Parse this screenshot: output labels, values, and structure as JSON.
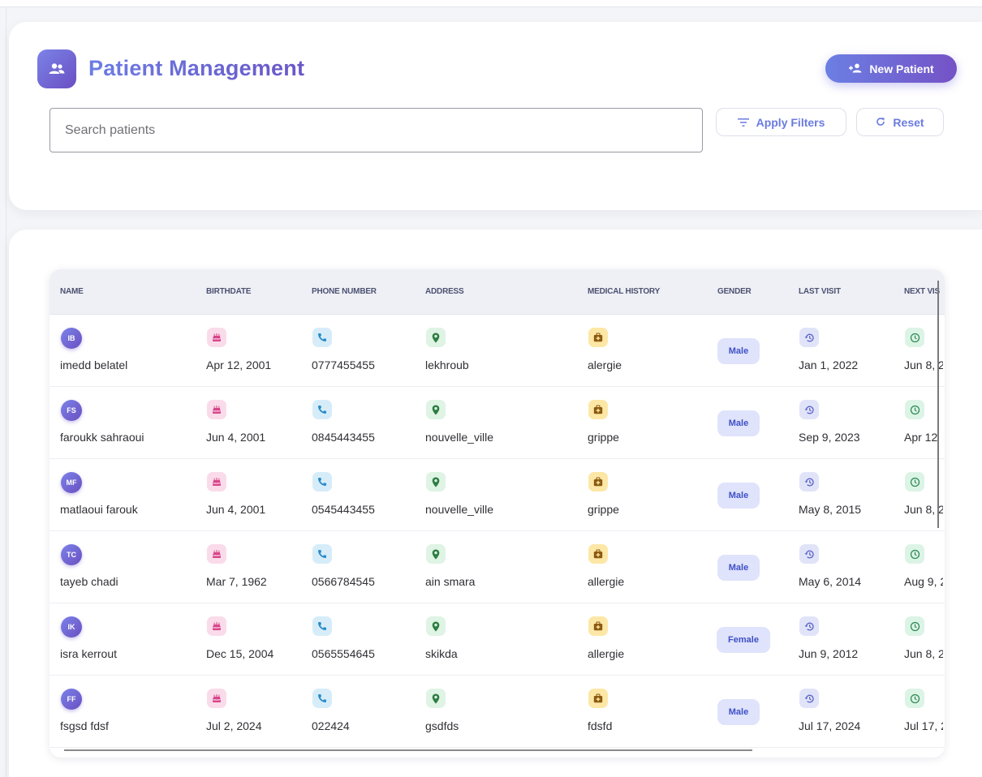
{
  "header": {
    "title": "Patient Management",
    "new_patient_label": "New Patient",
    "search_placeholder": "Search patients",
    "apply_filters_label": "Apply Filters",
    "reset_label": "Reset",
    "icons": {
      "title": "people-group-icon",
      "new_patient": "person-add-icon",
      "filter": "filter-lines-icon",
      "reset": "refresh-icon"
    }
  },
  "table": {
    "columns": [
      "NAME",
      "BIRTHDATE",
      "PHONE NUMBER",
      "ADDRESS",
      "MEDICAL HISTORY",
      "GENDER",
      "LAST VISIT",
      "NEXT VIS"
    ],
    "rows": [
      {
        "initials": "IB",
        "name": "imedd belatel",
        "birthdate": "Apr 12, 2001",
        "phone": "0777455455",
        "address": "lekhroub",
        "history": "alergie",
        "gender": "Male",
        "last_visit": "Jan 1, 2022",
        "next_visit": "Jun 8, 2"
      },
      {
        "initials": "FS",
        "name": "faroukk sahraoui",
        "birthdate": "Jun 4, 2001",
        "phone": "0845443455",
        "address": "nouvelle_ville",
        "history": "grippe",
        "gender": "Male",
        "last_visit": "Sep 9, 2023",
        "next_visit": "Apr 12"
      },
      {
        "initials": "MF",
        "name": "matlaoui farouk",
        "birthdate": "Jun 4, 2001",
        "phone": "0545443455",
        "address": "nouvelle_ville",
        "history": "grippe",
        "gender": "Male",
        "last_visit": "May 8, 2015",
        "next_visit": "Jun 8, 2"
      },
      {
        "initials": "TC",
        "name": "tayeb chadi",
        "birthdate": "Mar 7, 1962",
        "phone": "0566784545",
        "address": "ain smara",
        "history": "allergie",
        "gender": "Male",
        "last_visit": "May 6, 2014",
        "next_visit": "Aug 9, 2"
      },
      {
        "initials": "IK",
        "name": "isra kerrout",
        "birthdate": "Dec 15, 2004",
        "phone": "0565554645",
        "address": "skikda",
        "history": "allergie",
        "gender": "Female",
        "last_visit": "Jun 9, 2012",
        "next_visit": "Jun 8, 2"
      },
      {
        "initials": "FF",
        "name": "fsgsd fdsf",
        "birthdate": "Jul 2, 2024",
        "phone": "022424",
        "address": "gsdfds",
        "history": "fdsfd",
        "gender": "Male",
        "last_visit": "Jul 17, 2024",
        "next_visit": "Jul 17, 2"
      }
    ],
    "cell_icons": {
      "birthdate": "birthday-cake-icon",
      "phone": "phone-icon",
      "address": "location-pin-icon",
      "history": "medical-kit-icon",
      "last_visit": "history-icon",
      "next_visit": "clock-icon"
    }
  },
  "colors": {
    "accent_start": "#6b7fe3",
    "accent_end": "#7552c6",
    "pink": "#d9458a",
    "blue": "#2a8bc9",
    "green": "#2e7d43",
    "gold": "#8a5a10",
    "purple": "#5a64c8",
    "mint": "#2f8a57"
  }
}
